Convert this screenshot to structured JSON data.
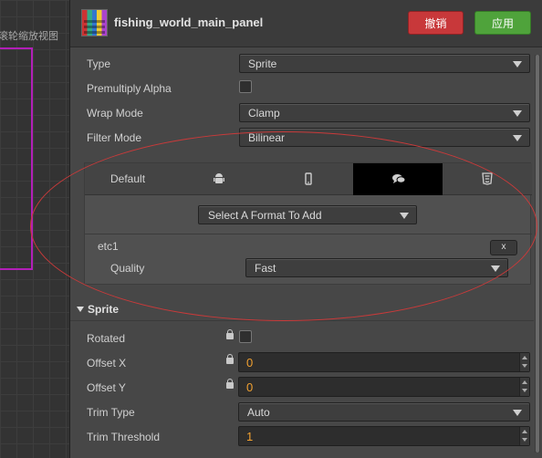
{
  "scene": {
    "hint": "滚轮缩放视图"
  },
  "header": {
    "asset_name": "fishing_world_main_panel",
    "revert_label": "撤销",
    "apply_label": "应用",
    "colors": {
      "revert": "#c8383a",
      "apply": "#4fa33b"
    }
  },
  "texture": {
    "type": {
      "label": "Type",
      "value": "Sprite"
    },
    "premultiply_alpha": {
      "label": "Premultiply Alpha",
      "checked": false
    },
    "wrap_mode": {
      "label": "Wrap Mode",
      "value": "Clamp"
    },
    "filter_mode": {
      "label": "Filter Mode",
      "value": "Bilinear"
    }
  },
  "platform": {
    "tabs": [
      {
        "label": "Default",
        "icon": "default"
      },
      {
        "icon": "android-icon"
      },
      {
        "icon": "phone-icon"
      },
      {
        "icon": "chat-bubbles-icon",
        "active": true
      },
      {
        "icon": "html5-icon"
      }
    ],
    "format_select": "Select A Format To Add",
    "format_name": "etc1",
    "remove_label": "x",
    "quality_label": "Quality",
    "quality_value": "Fast"
  },
  "sprite": {
    "section_title": "Sprite",
    "rotated": {
      "label": "Rotated",
      "checked": false
    },
    "offset_x": {
      "label": "Offset X",
      "value": "0"
    },
    "offset_y": {
      "label": "Offset Y",
      "value": "0"
    },
    "trim_type": {
      "label": "Trim Type",
      "value": "Auto"
    },
    "trim_threshold": {
      "label": "Trim Threshold",
      "value": "1"
    }
  }
}
